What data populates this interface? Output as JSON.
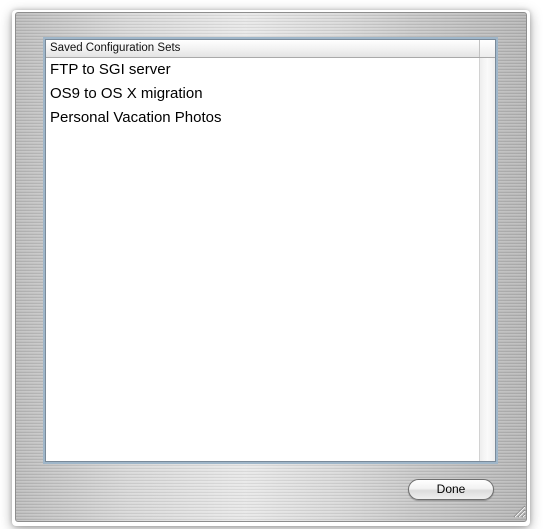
{
  "dialog": {
    "list": {
      "column_header": "Saved Configuration Sets",
      "items": [
        "FTP to SGI server",
        "OS9 to OS X migration",
        "Personal Vacation Photos"
      ]
    },
    "done_label": "Done",
    "resize_icon": "resize-grip-icon"
  }
}
